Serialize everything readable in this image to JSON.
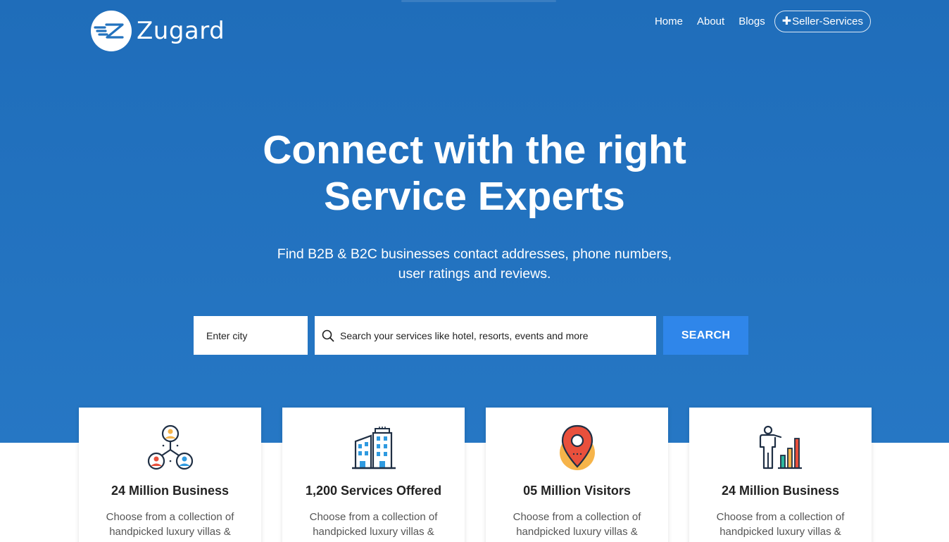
{
  "brand": {
    "name": "Zugard",
    "logo_icon": "zugard-z-logo"
  },
  "nav": {
    "items": [
      "Home",
      "About",
      "Blogs"
    ],
    "cta": {
      "label": "Seller-Services",
      "icon": "plus-icon"
    }
  },
  "hero": {
    "title_line1": "Connect with the right",
    "title_line2": "Service Experts",
    "subtitle_line1": "Find B2B & B2C businesses contact addresses, phone numbers,",
    "subtitle_line2": "user ratings and reviews."
  },
  "search": {
    "city_placeholder": "Enter city",
    "service_placeholder": "Search your services like hotel, resorts, events and more",
    "button_label": "SEARCH",
    "icon": "search-icon"
  },
  "cards": [
    {
      "title": "24 Million Business",
      "text": "Choose from a collection of handpicked luxury villas &",
      "icon": "people-network-icon"
    },
    {
      "title": "1,200 Services Offered",
      "text": "Choose from a collection of handpicked luxury villas &",
      "icon": "buildings-icon"
    },
    {
      "title": "05 Million Visitors",
      "text": "Choose from a collection of handpicked luxury villas &",
      "icon": "location-pin-icon"
    },
    {
      "title": "24 Million Business",
      "text": "Choose from a collection of handpicked luxury villas &",
      "icon": "presenter-chart-icon"
    }
  ],
  "colors": {
    "hero_bg": "#2272be",
    "button": "#2f86ea",
    "white": "#ffffff"
  }
}
